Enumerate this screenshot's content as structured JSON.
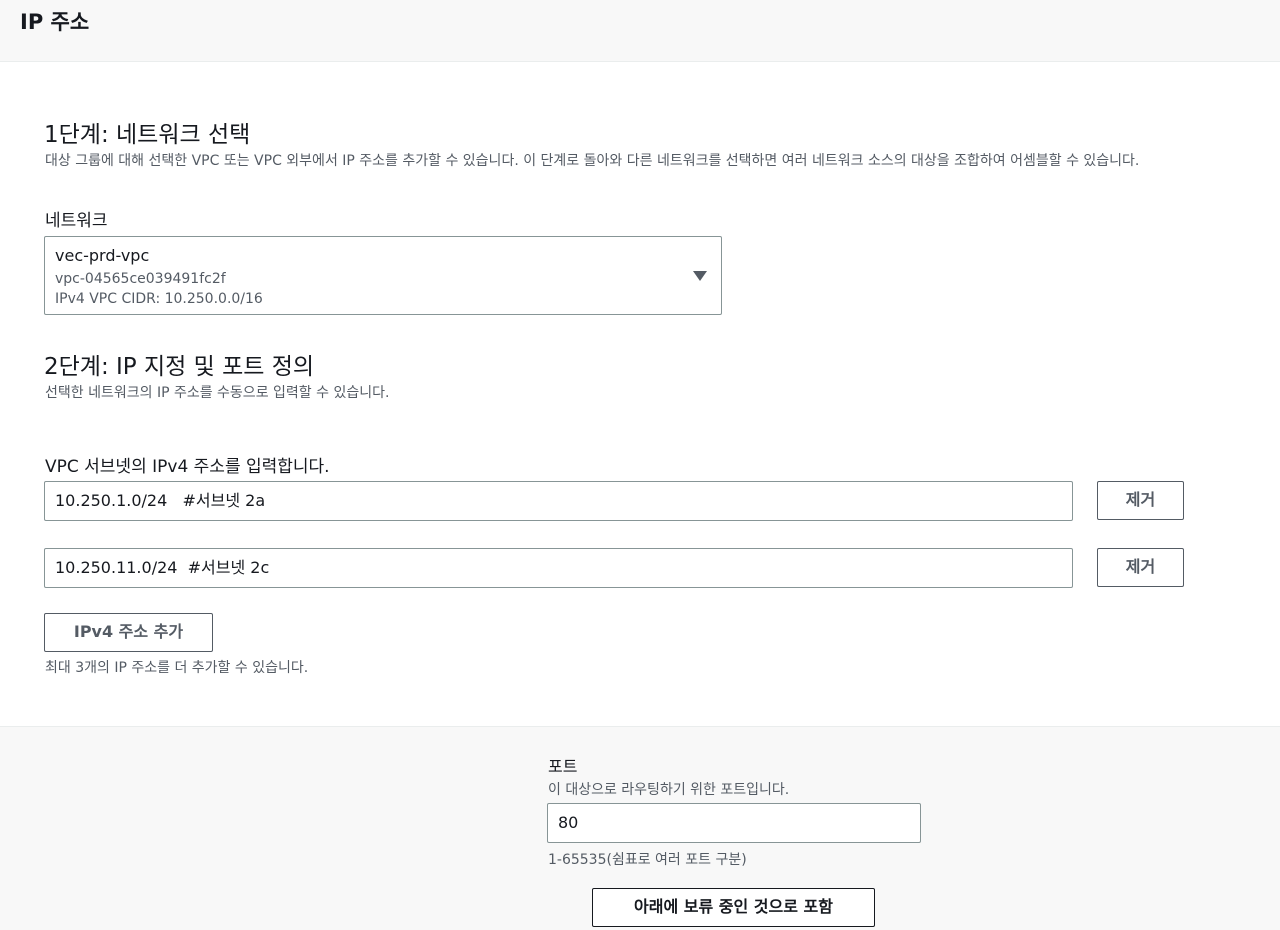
{
  "header": {
    "title": "IP 주소"
  },
  "step1": {
    "title": "1단계: 네트워크 선택",
    "description": "대상 그룹에 대해 선택한 VPC 또는 VPC 외부에서 IP 주소를 추가할 수 있습니다. 이 단계로 돌아와 다른 네트워크를 선택하면 여러 네트워크 소스의 대상을 조합하여 어셈블할 수 있습니다.",
    "network_label": "네트워크",
    "network": {
      "name": "vec-prd-vpc",
      "id": "vpc-04565ce039491fc2f",
      "cidr": "IPv4 VPC CIDR: 10.250.0.0/16"
    }
  },
  "step2": {
    "title": "2단계: IP 지정 및 포트 정의",
    "description": "선택한 네트워크의 IP 주소를 수동으로 입력할 수 있습니다.",
    "ipv4_label": "VPC 서브넷의 IPv4 주소를 입력합니다.",
    "addresses": [
      {
        "value": "10.250.1.0/24   #서브넷 2a",
        "remove_label": "제거"
      },
      {
        "value": "10.250.11.0/24  #서브넷 2c",
        "remove_label": "제거"
      }
    ],
    "add_button": "IPv4 주소 추가",
    "add_hint": "최대 3개의 IP 주소를 더 추가할 수 있습니다."
  },
  "port": {
    "label": "포트",
    "description": "이 대상으로 라우팅하기 위한 포트입니다.",
    "value": "80",
    "hint": "1-65535(쉼표로 여러 포트 구분)",
    "include_button": "아래에 보류 중인 것으로 포함"
  }
}
